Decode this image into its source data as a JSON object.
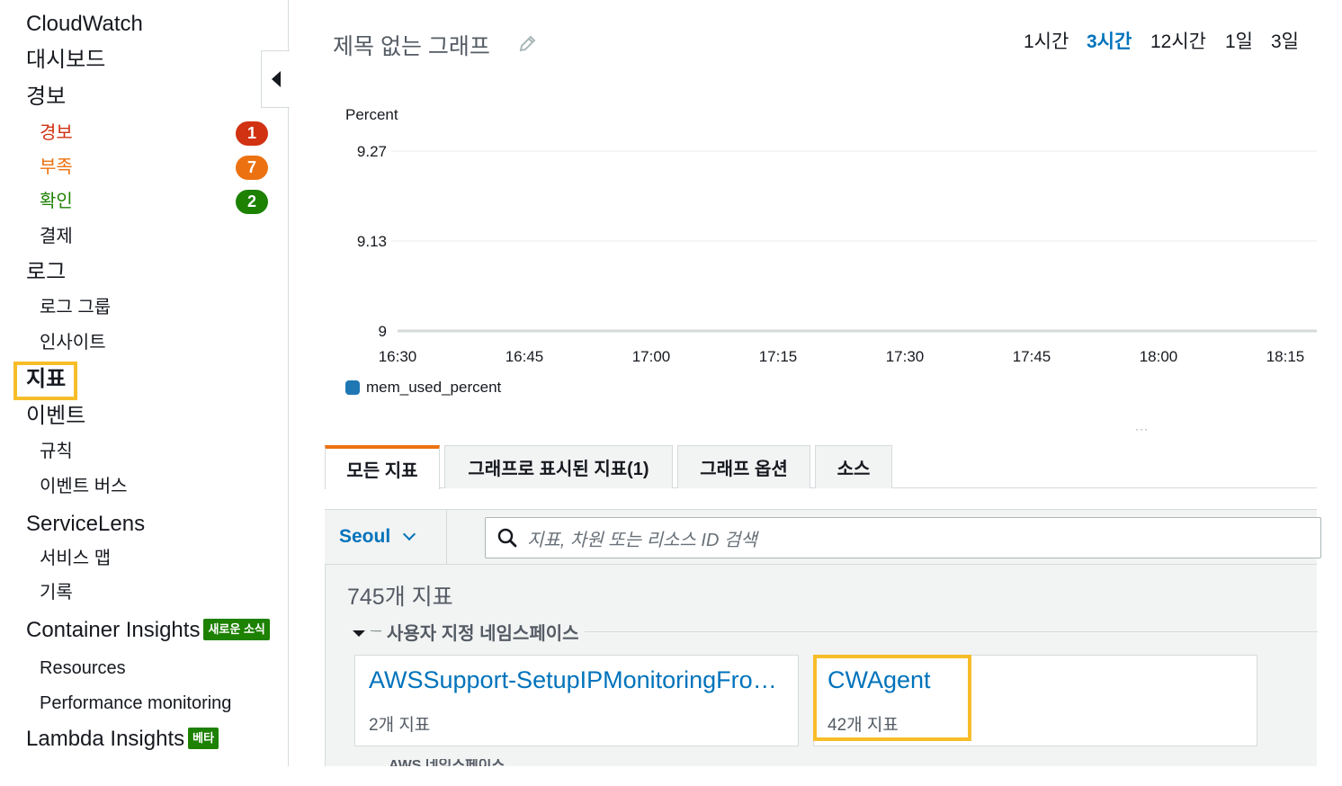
{
  "sidebar": {
    "title": "CloudWatch",
    "dashboards": "대시보드",
    "alarms_heading": "경보",
    "alarm_states": [
      {
        "label": "경보",
        "count": "1"
      },
      {
        "label": "부족",
        "count": "7"
      },
      {
        "label": "확인",
        "count": "2"
      }
    ],
    "billing": "결제",
    "logs_heading": "로그",
    "log_groups": "로그 그룹",
    "insights": "인사이트",
    "metrics": "지표",
    "events_heading": "이벤트",
    "rules": "규칙",
    "event_buses": "이벤트 버스",
    "servicelens": "ServiceLens",
    "service_map": "서비스 맵",
    "traces": "기록",
    "container_insights": "Container Insights",
    "container_tag": "새로운 소식",
    "resources": "Resources",
    "performance_monitoring": "Performance monitoring",
    "lambda_insights": "Lambda Insights",
    "lambda_tag": "베타"
  },
  "graph": {
    "title": "제목 없는 그래프",
    "time_ranges": [
      "1시간",
      "3시간",
      "12시간",
      "1일",
      "3일"
    ],
    "active_time_range": "3시간"
  },
  "chart_data": {
    "type": "line",
    "ylabel": "Percent",
    "y_ticks": [
      "9.27",
      "9.13",
      "9"
    ],
    "x_ticks": [
      "16:30",
      "16:45",
      "17:00",
      "17:15",
      "17:30",
      "17:45",
      "18:00",
      "18:15"
    ],
    "series": [
      {
        "name": "mem_used_percent",
        "values": []
      }
    ],
    "grid": true,
    "legend": "bottom-left",
    "series_color": "#1f77b4"
  },
  "tabs": [
    "모든 지표",
    "그래프로 표시된 지표(1)",
    "그래프 옵션",
    "소스"
  ],
  "search": {
    "region": "Seoul",
    "placeholder": "지표, 차원 또는 리소스 ID 검색"
  },
  "browser": {
    "metric_count": "745개 지표",
    "namespace_group": "사용자 지정 네임스페이스",
    "namespaces": [
      {
        "name": "AWSSupport-SetupIPMonitoringFromVPC",
        "count": "2개 지표"
      },
      {
        "name": "CWAgent",
        "count": "42개 지표"
      }
    ],
    "next_group": "AWS 네임스페이스"
  },
  "colors": {
    "accent_link": "#0073bb",
    "alarm_red": "#d13212",
    "insufficient_orange": "#ec7211",
    "ok_green": "#1d8102",
    "highlight_yellow": "#f7bd29"
  }
}
